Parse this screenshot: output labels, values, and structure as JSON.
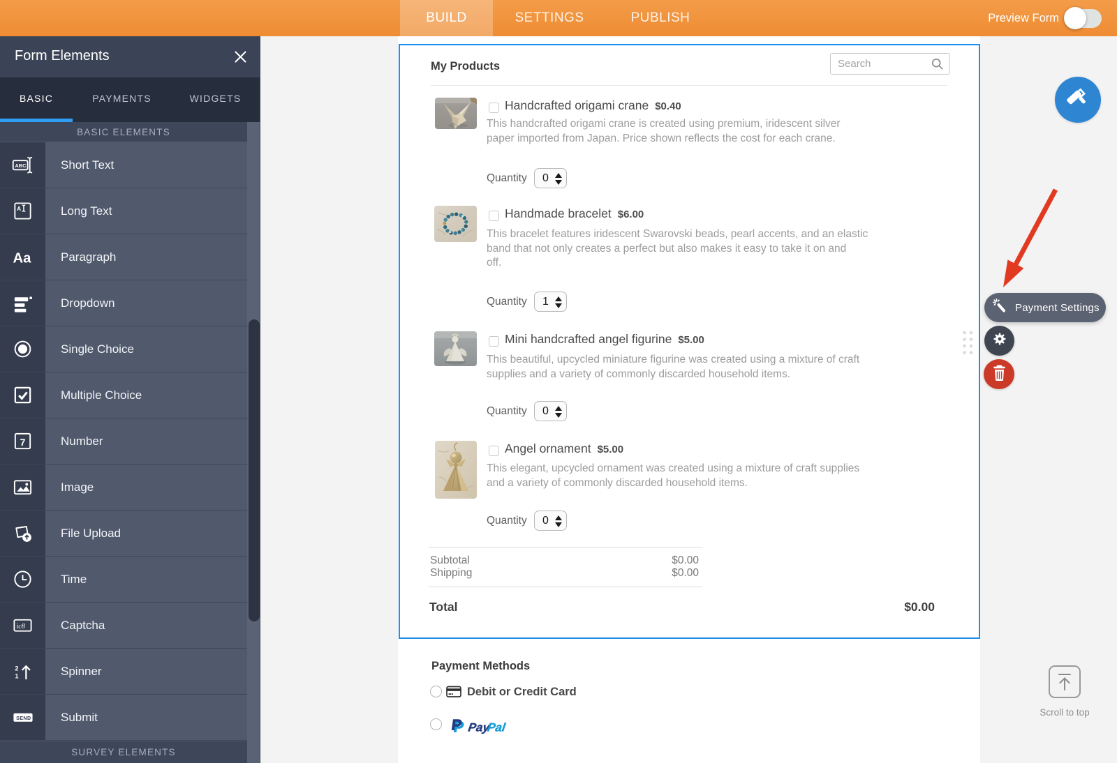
{
  "topbar": {
    "tabs": [
      {
        "label": "BUILD",
        "active": true
      },
      {
        "label": "SETTINGS",
        "active": false
      },
      {
        "label": "PUBLISH",
        "active": false
      }
    ],
    "preview_label": "Preview Form",
    "toggle_state": "off"
  },
  "sidebar": {
    "title": "Form Elements",
    "tabs": [
      {
        "label": "BASIC",
        "active": true
      },
      {
        "label": "PAYMENTS",
        "active": false
      },
      {
        "label": "WIDGETS",
        "active": false
      }
    ],
    "section_basic": "BASIC ELEMENTS",
    "section_survey": "SURVEY ELEMENTS",
    "items": [
      {
        "label": "Short Text",
        "icon": "short-text"
      },
      {
        "label": "Long Text",
        "icon": "long-text"
      },
      {
        "label": "Paragraph",
        "icon": "paragraph"
      },
      {
        "label": "Dropdown",
        "icon": "dropdown"
      },
      {
        "label": "Single Choice",
        "icon": "single-choice"
      },
      {
        "label": "Multiple Choice",
        "icon": "multiple-choice"
      },
      {
        "label": "Number",
        "icon": "number"
      },
      {
        "label": "Image",
        "icon": "image"
      },
      {
        "label": "File Upload",
        "icon": "file-upload"
      },
      {
        "label": "Time",
        "icon": "time"
      },
      {
        "label": "Captcha",
        "icon": "captcha"
      },
      {
        "label": "Spinner",
        "icon": "spinner"
      },
      {
        "label": "Submit",
        "icon": "submit"
      }
    ]
  },
  "form": {
    "products_header": {
      "title": "My Products",
      "search_placeholder": "Search"
    },
    "quantity_label": "Quantity",
    "products": [
      {
        "name": "Handcrafted origami crane",
        "price": "$0.40",
        "desc_lines": [
          "This handcrafted origami crane is created using premium, iridescent silver",
          "paper imported from Japan. Price shown reflects the cost for each crane."
        ],
        "quantity": "0",
        "image": "origami-crane"
      },
      {
        "name": "Handmade bracelet",
        "price": "$6.00",
        "desc_lines": [
          "This bracelet features iridescent Swarovski beads, pearl accents, and an elastic",
          "band that not only creates a perfect but also makes it easy to take it on and",
          "off."
        ],
        "quantity": "1",
        "image": "bracelet"
      },
      {
        "name": "Mini handcrafted angel figurine",
        "price": "$5.00",
        "desc_lines": [
          "This beautiful, upcycled miniature figurine was created using a mixture of craft",
          "supplies and a variety of commonly discarded household items."
        ],
        "quantity": "0",
        "image": "angel-figurine"
      },
      {
        "name": "Angel ornament",
        "price": "$5.00",
        "desc_lines": [
          "This elegant, upcycled ornament was created using a mixture of craft supplies",
          "and a variety of commonly discarded household items."
        ],
        "quantity": "0",
        "image": "angel-ornament"
      }
    ],
    "summary": {
      "subtotal_label": "Subtotal",
      "subtotal_value": "$0.00",
      "shipping_label": "Shipping",
      "shipping_value": "$0.00",
      "total_label": "Total",
      "total_value": "$0.00"
    },
    "payment_methods": {
      "title": "Payment Methods",
      "options": [
        {
          "label": "Debit or Credit Card",
          "icon": "credit-card"
        },
        {
          "label": "PayPal",
          "icon": "paypal",
          "brand_prefix": "Pay",
          "brand_suffix": "Pal"
        }
      ]
    }
  },
  "right_rail": {
    "payment_settings_label": "Payment Settings",
    "scroll_top_label": "Scroll to top"
  },
  "colors": {
    "topbar_orange": "#ee8c33",
    "selection_blue": "#1e8fef",
    "sidebar_slate": "#515a6d",
    "sidebar_dark": "#262d3d",
    "tab_underline_blue": "#2f9df1",
    "roller_button_blue": "#2e86d3",
    "danger_red": "#cb3a28",
    "arrow_red": "#e23a20",
    "paypal_navy": "#253b80",
    "paypal_blue": "#179bd7"
  }
}
